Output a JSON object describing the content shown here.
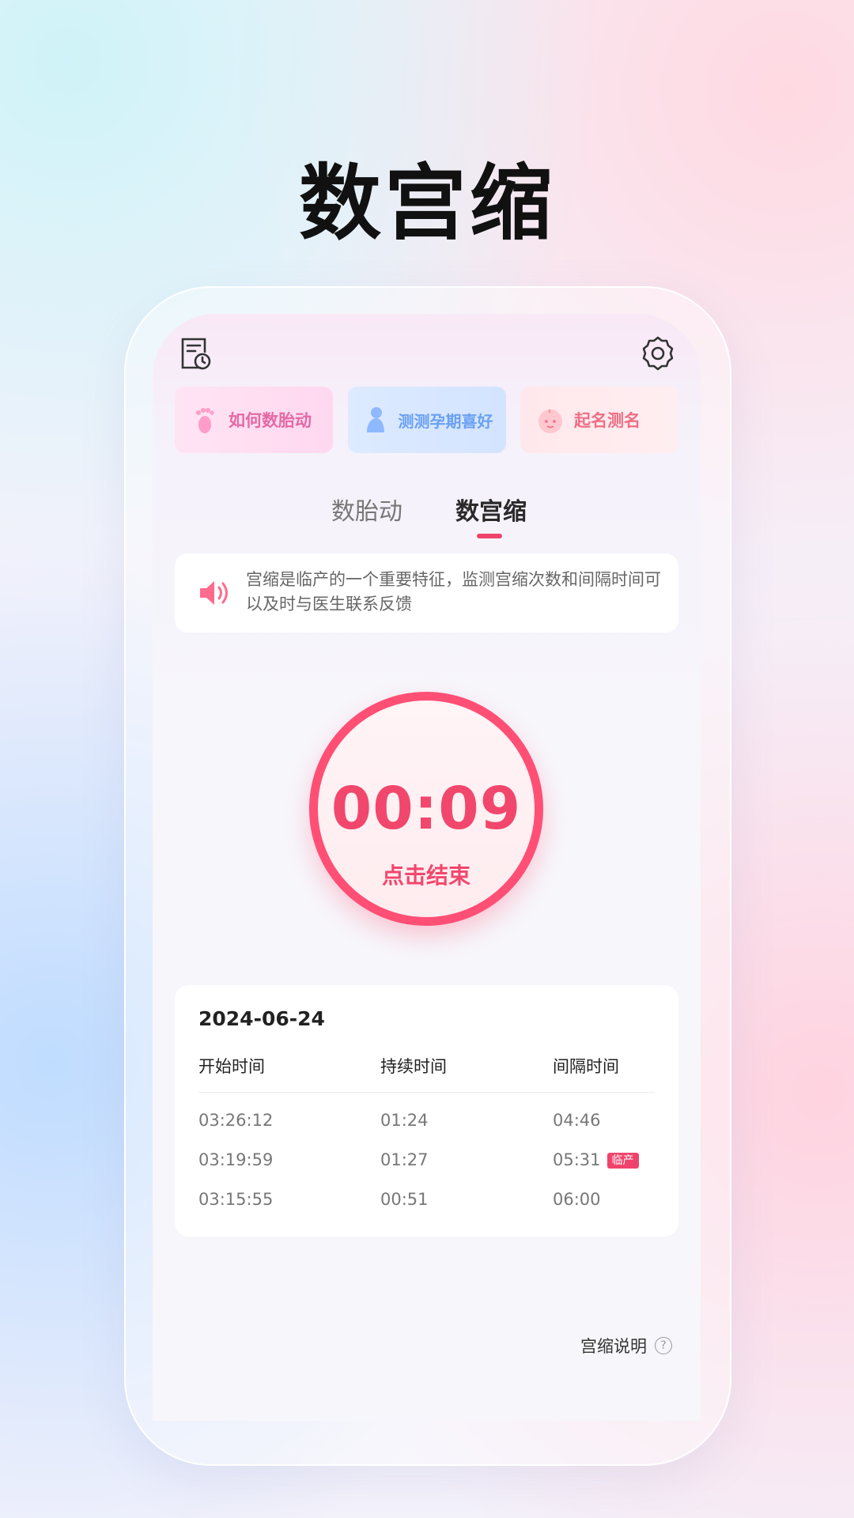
{
  "headline": "数宫缩",
  "quick_links": [
    {
      "label": "如何数胎动",
      "icon": "foot-icon"
    },
    {
      "label": "测测孕期喜好",
      "icon": "baby-silhouette-icon"
    },
    {
      "label": "起名测名",
      "icon": "baby-face-icon"
    }
  ],
  "tabs": [
    {
      "label": "数胎动",
      "active": false
    },
    {
      "label": "数宫缩",
      "active": true
    }
  ],
  "tip": {
    "icon": "speaker-icon",
    "text": "宫缩是临产的一个重要特征，监测宫缩次数和间隔时间可以及时与医生联系反馈"
  },
  "timer": {
    "time": "00:09",
    "action": "点击结束"
  },
  "records": {
    "date": "2024-06-24",
    "columns": [
      "开始时间",
      "持续时间",
      "间隔时间"
    ],
    "rows": [
      {
        "start": "03:26:12",
        "duration": "01:24",
        "interval": "04:46",
        "badge": ""
      },
      {
        "start": "03:19:59",
        "duration": "01:27",
        "interval": "05:31",
        "badge": "临产"
      },
      {
        "start": "03:15:55",
        "duration": "00:51",
        "interval": "06:00",
        "badge": ""
      }
    ]
  },
  "help": {
    "label": "宫缩说明",
    "icon_glyph": "?"
  },
  "colors": {
    "accent": "#f0436c",
    "timer": "#ff4f75"
  }
}
